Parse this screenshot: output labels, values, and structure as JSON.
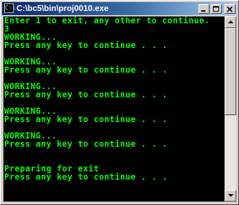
{
  "window": {
    "title": "C:\\bc5\\bin\\proj0010.exe",
    "icon_glyph": "C:\\"
  },
  "console": {
    "text_color": "#00ff00",
    "background": "#000000",
    "lines": [
      "Enter 1 to exit, any other to continue.",
      "3",
      "WORKING...",
      "Press any key to continue . . .",
      "",
      "WORKING...",
      "Press any key to continue . . .",
      "",
      "WORKING...",
      "Press any key to continue . . .",
      "",
      "WORKING...",
      "Press any key to continue . . .",
      "",
      "WORKING...",
      "Press any key to continue . . .",
      "",
      "",
      "Preparing for exit",
      "Press any key to continue . . ."
    ]
  },
  "controls": {
    "minimize_icon": "minimize-icon",
    "maximize_icon": "maximize-icon",
    "close_icon": "close-icon",
    "scroll_up_icon": "arrow-up-icon",
    "scroll_down_icon": "arrow-down-icon"
  }
}
